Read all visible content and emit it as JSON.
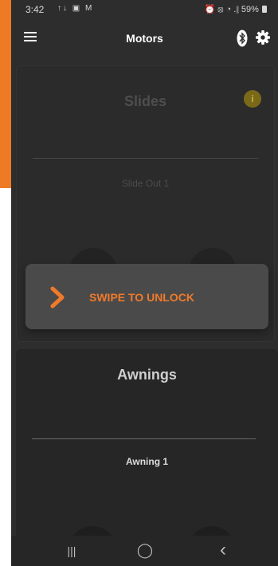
{
  "status_bar": {
    "time": "3:42",
    "left_icons": "↑↓ ▣ M",
    "right_icons": "⏰ ⦻ ◔ .∥",
    "battery": "59%"
  },
  "app_bar": {
    "title": "Motors",
    "menu_icon": "hamburger-menu-icon",
    "bluetooth_icon": "bluetooth-icon",
    "settings_icon": "gear-icon"
  },
  "slides": {
    "heading": "Slides",
    "info_icon": "i",
    "motor_label": "Slide Out 1"
  },
  "lock": {
    "label": "SWIPE TO UNLOCK"
  },
  "awnings": {
    "heading": "Awnings",
    "motor_label": "Awning 1"
  },
  "nav": {
    "recents": "|||",
    "home": "◯",
    "back": "‹"
  },
  "colors": {
    "accent": "#f07a2a",
    "background": "#2d2d2d",
    "info_badge": "#7a6a18"
  }
}
